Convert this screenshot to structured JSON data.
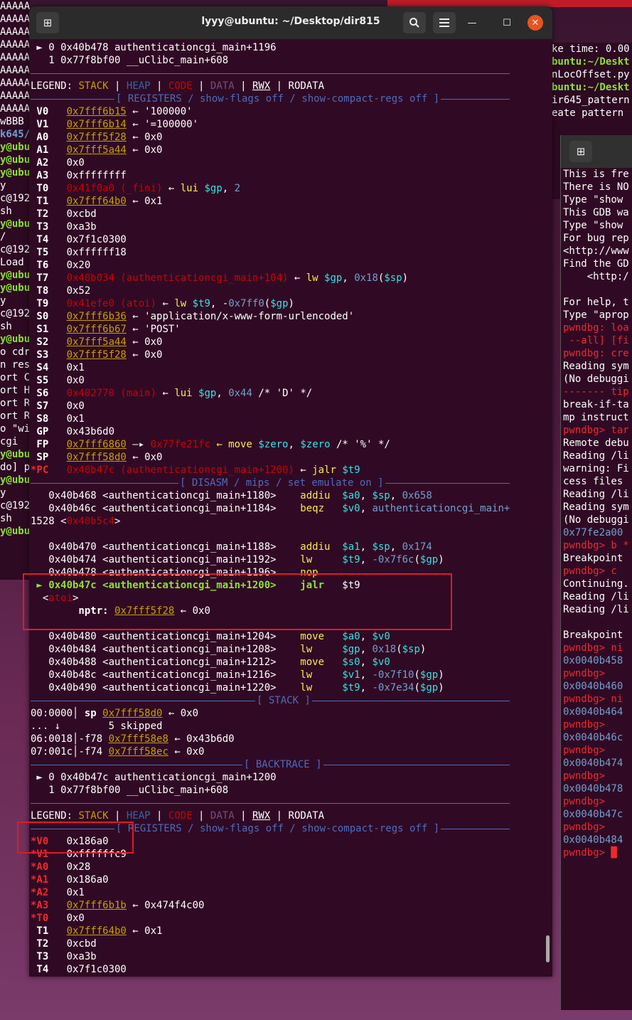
{
  "window": {
    "title": "lyyy@ubuntu: ~/Desktop/dir815",
    "new_tab_icon": "new-tab-icon",
    "search_icon": "search-icon",
    "menu_icon": "hamburger-menu-icon"
  },
  "bg_left_lines": [
    "AAAAA",
    "AAAAA",
    "AAAAA",
    "AAAAA",
    "AAAAA",
    "AAAAA",
    "AAAAA",
    "AAAAA",
    "AAAAA",
    "wBBB",
    "k645/",
    "y@ubu",
    "y@ubu",
    "y@ubu",
    "y",
    "c@192",
    "sh",
    "y@ubu",
    "/",
    "c@192",
    "Load",
    "y@ubu",
    "y@ubu",
    "y",
    "c@192",
    "sh",
    "y@ubu",
    "o cdr",
    "n res",
    "ort C",
    "ort H",
    "ort R",
    "ort R",
    "o \"wi",
    "cgi",
    "y@ubu",
    "do] p",
    "y@ubu",
    "y",
    "c@192",
    "sh",
    "y@ubu"
  ],
  "bg_right_top_lines": [
    "ke time: 0.00",
    "buntu:~/Deskt",
    "nLocOffset.py",
    "buntu:~/Deskt",
    "ir645_pattern",
    "eate pattern "
  ],
  "bg_right_lines": [
    "This is fre",
    "There is NO",
    "Type \"show ",
    "This GDB wa",
    "Type \"show ",
    "For bug rep",
    "<http://www",
    "Find the GD",
    "    <http:/",
    "",
    "For help, t",
    "Type \"aprop",
    "pwndbg: loa",
    " --all] [fi",
    "pwndbg: cre",
    "Reading sym",
    "(No debuggi",
    "------- tip",
    "break-if-ta",
    "mp instruct",
    "pwndbg> tar",
    "Remote debu",
    "Reading /li",
    "warning: Fi",
    "cess files ",
    "Reading /li",
    "Reading sym",
    "(No debuggi",
    "0x77fe2a00 ",
    "pwndbg> b *",
    "Breakpoint ",
    "pwndbg> c",
    "Continuing.",
    "Reading /li",
    "Reading /li",
    "",
    "Breakpoint ",
    "pwndbg> ni",
    "0x0040b458 ",
    "pwndbg> ",
    "0x0040b460 ",
    "pwndbg> ni",
    "0x0040b464 ",
    "pwndbg> ",
    "0x0040b46c ",
    "pwndbg> ",
    "0x0040b474 ",
    "pwndbg> ",
    "0x0040b478 ",
    "pwndbg> ",
    "0x0040b47c ",
    "pwndbg> ",
    "0x0040b484 ",
    "pwndbg> █"
  ],
  "backtrace1": [
    "► 0 0x40b478 authenticationcgi_main+1196",
    "  1 0x77f8bf00 __uClibc_main+608"
  ],
  "legend": {
    "label": "LEGEND: ",
    "stack": "STACK",
    "heap": "HEAP",
    "code": "CODE",
    "data": "DATA",
    "rwx": "RWX",
    "rodata": "RODATA",
    "sep": " | "
  },
  "registers_header": "[ REGISTERS / show-flags off / show-compact-regs off ]",
  "registers1": [
    {
      "name": "V0",
      "addr": "0x7fff6b15",
      "rest": " ← '100000'"
    },
    {
      "name": "V1",
      "addr": "0x7fff6b14",
      "rest": " ← '=100000'"
    },
    {
      "name": "A0",
      "addr": "0x7fff5f28",
      "rest": " ← 0x0"
    },
    {
      "name": "A1",
      "addr": "0x7fff5a44",
      "rest": " ← 0x0"
    },
    {
      "name": "A2",
      "val": "0x0"
    },
    {
      "name": "A3",
      "val": "0xffffffff"
    },
    {
      "name": "T0",
      "code": "0x41f0a0 (_fini)",
      "rest": " ← ",
      "ins": "lui",
      "args": " $gp, 2"
    },
    {
      "name": "T1",
      "addr": "0x7fff64b0",
      "rest": " ← 0x1"
    },
    {
      "name": "T2",
      "val": "0xcbd"
    },
    {
      "name": "T3",
      "val": "0xa3b"
    },
    {
      "name": "T4",
      "val": "0x7f1c0300"
    },
    {
      "name": "T5",
      "val": "0xffffff18"
    },
    {
      "name": "T6",
      "val": "0x20"
    },
    {
      "name": "T7",
      "code": "0x40b034 (authenticationcgi_main+104)",
      "rest": " ← ",
      "ins": "lw",
      "args": " $gp, 0x18($sp)"
    },
    {
      "name": "T8",
      "val": "0x52"
    },
    {
      "name": "T9",
      "code": "0x41efe0 (atoi)",
      "rest": " ← ",
      "ins": "lw",
      "args": " $t9, -0x7ff0($gp)"
    },
    {
      "name": "S0",
      "addr": "0x7fff6b36",
      "rest": " ← 'application/x-www-form-urlencoded'"
    },
    {
      "name": "S1",
      "addr": "0x7fff6b67",
      "rest": " ← 'POST'"
    },
    {
      "name": "S2",
      "addr": "0x7fff5a44",
      "rest": " ← 0x0"
    },
    {
      "name": "S3",
      "addr": "0x7fff5f28",
      "rest": " ← 0x0"
    },
    {
      "name": "S4",
      "val": "0x1"
    },
    {
      "name": "S5",
      "val": "0x0"
    },
    {
      "name": "S6",
      "code": "0x402770 (main)",
      "rest": " ← ",
      "ins": "lui",
      "args": " $gp, 0x44 /* 'D' */"
    },
    {
      "name": "S7",
      "val": "0x0"
    },
    {
      "name": "S8",
      "val": "0x1"
    },
    {
      "name": "GP",
      "val": "0x43b6d0"
    },
    {
      "name": "FP",
      "addr": "0x7fff6860",
      "rest": " —▸ ",
      "code2": "0x77fe21fc",
      "ins": " ← move",
      "args": " $zero, $zero /* '%' */"
    },
    {
      "name": "SP",
      "addr": "0x7fff58d0",
      "rest": " ← 0x0"
    },
    {
      "name": "*PC",
      "changed": true,
      "code": "0x40b47c (authenticationcgi_main+1200)",
      "rest": " ← ",
      "ins": "jalr",
      "args": " $t9"
    }
  ],
  "disasm_header": "[ DISASM / mips / set emulate on ]",
  "disasm": [
    {
      "a": "   0x40b468 <authenticationcgi_main+1180>",
      "i": "    addiu",
      "o": "  $a0, $sp, 0x658"
    },
    {
      "a": "   0x40b46c <authenticationcgi_main+1184>",
      "i": "    beqz",
      "o": "   $v0, authenticationcgi_main+"
    },
    {
      "a": "1528 <0x40b5c4>",
      "i": "",
      "o": ""
    },
    {
      "a": "",
      "i": "",
      "o": ""
    },
    {
      "a": "   0x40b470 <authenticationcgi_main+1188>",
      "i": "    addiu",
      "o": "  $a1, $sp, 0x174"
    },
    {
      "a": "   0x40b474 <authenticationcgi_main+1192>",
      "i": "    lw",
      "o": "     $t9, -0x7f6c($gp)"
    },
    {
      "a": "   0x40b478 <authenticationcgi_main+1196>",
      "i": "    nop",
      "o": ""
    },
    {
      "a": " ► 0x40b47c <authenticationcgi_main+1200>",
      "i": "    jalr",
      "o": "   $t9",
      "cur": true
    },
    {
      "a": "  <atoi>",
      "i": "",
      "o": ""
    },
    {
      "a": "        nptr: ",
      "ptr": "0x7fff5f28",
      "o2": " ← 0x0"
    },
    {
      "a": "",
      "i": "",
      "o": ""
    },
    {
      "a": "   0x40b480 <authenticationcgi_main+1204>",
      "i": "    move",
      "o": "   $a0, $v0"
    },
    {
      "a": "   0x40b484 <authenticationcgi_main+1208>",
      "i": "    lw",
      "o": "     $gp, 0x18($sp)"
    },
    {
      "a": "   0x40b488 <authenticationcgi_main+1212>",
      "i": "    move",
      "o": "   $s0, $v0"
    },
    {
      "a": "   0x40b48c <authenticationcgi_main+1216>",
      "i": "    lw",
      "o": "     $v1, -0x7f10($gp)"
    },
    {
      "a": "   0x40b490 <authenticationcgi_main+1220>",
      "i": "    lw",
      "o": "     $t9, -0x7e34($gp)"
    }
  ],
  "stack_header": "[ STACK ]",
  "stack": [
    {
      "off": "00:0000│ ",
      "reg": "sp ",
      "addr": "0x7fff58d0",
      "rest": " ← 0x0"
    },
    {
      "off": "... ↓        ",
      "reg": "",
      "addr": "",
      "rest": "5 skipped"
    },
    {
      "off": "06:0018│",
      "reg": "-f78 ",
      "addr": "0x7fff58e8",
      "rest": " ← 0x43b6d0"
    },
    {
      "off": "07:001c│",
      "reg": "-f74 ",
      "addr": "0x7fff58ec",
      "rest": " ← 0x0"
    }
  ],
  "backtrace_header": "[ BACKTRACE ]",
  "backtrace2": [
    "► 0 0x40b47c authenticationcgi_main+1200",
    "  1 0x77f8bf00 __uClibc_main+608"
  ],
  "registers2": [
    {
      "name": "*V0",
      "val": "0x186a0",
      "changed": true
    },
    {
      "name": "*V1",
      "val": "0xffffffc9",
      "changed": true
    },
    {
      "name": "*A0",
      "val": "0x28",
      "changed": true
    },
    {
      "name": "*A1",
      "val": "0x186a0",
      "changed": true
    },
    {
      "name": "*A2",
      "val": "0x1",
      "changed": true
    },
    {
      "name": "*A3",
      "addr": "0x7fff6b1b",
      "rest": " ← 0x474f4c00",
      "changed": true
    },
    {
      "name": "*T0",
      "val": "0x0",
      "changed": true
    },
    {
      "name": "T1",
      "addr": "0x7fff64b0",
      "rest": " ← 0x1"
    },
    {
      "name": "T2",
      "val": "0xcbd"
    },
    {
      "name": "T3",
      "val": "0xa3b"
    },
    {
      "name": "T4",
      "val": "0x7f1c0300"
    }
  ],
  "colors": {
    "highlight_box": "#e01b24",
    "terminal_bg": "#300a24",
    "close_button": "#e95420"
  }
}
